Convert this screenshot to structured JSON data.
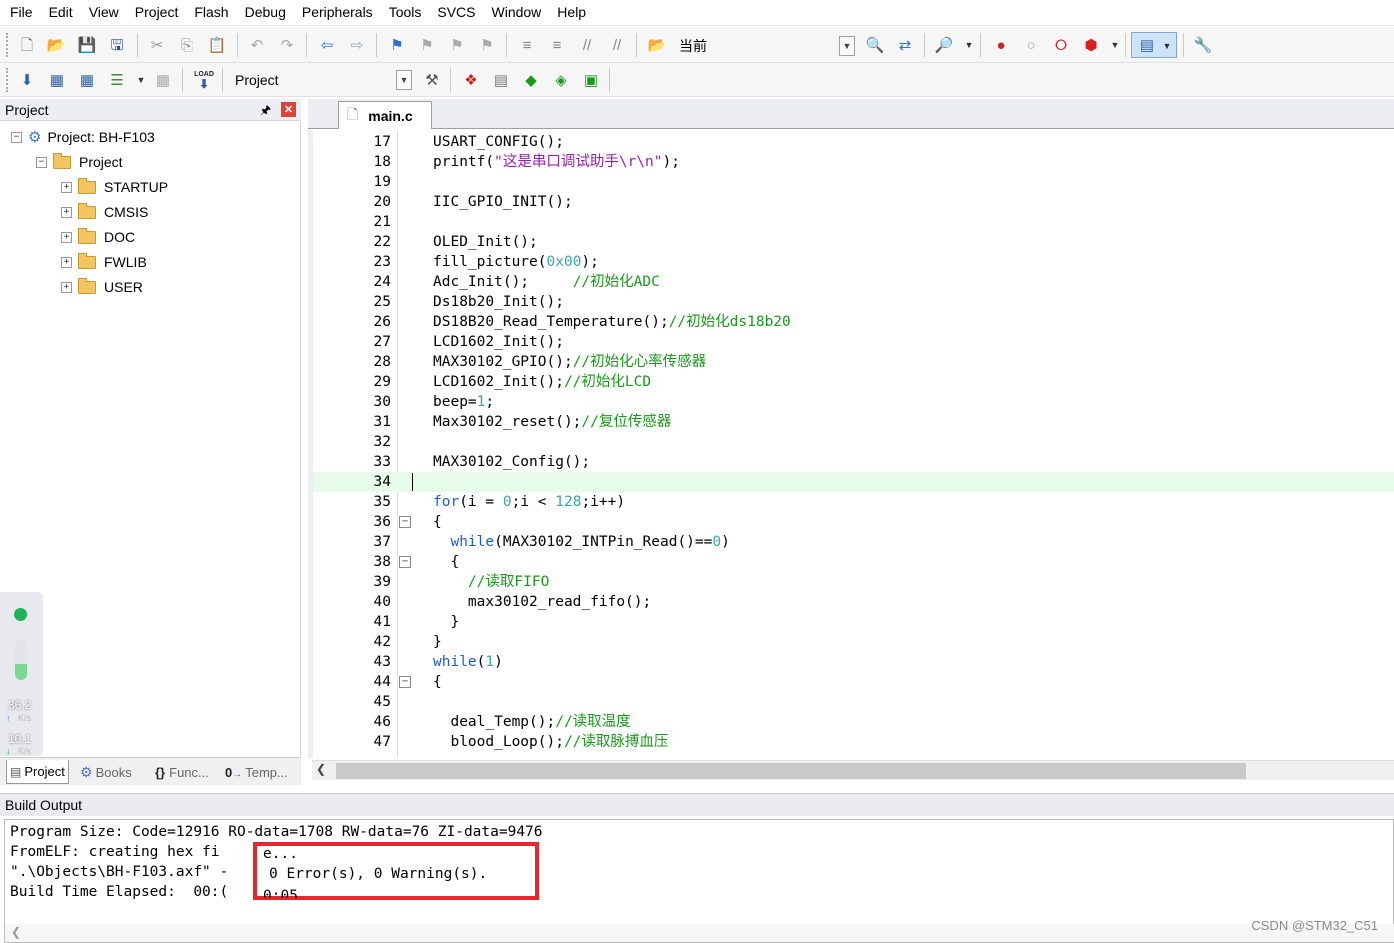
{
  "menu": [
    "File",
    "Edit",
    "View",
    "Project",
    "Flash",
    "Debug",
    "Peripherals",
    "Tools",
    "SVCS",
    "Window",
    "Help"
  ],
  "toolbar1": {
    "combo_value": "当前"
  },
  "toolbar2": {
    "target_value": "Project",
    "load_label": "LOAD"
  },
  "project_panel": {
    "title": "Project",
    "tree": {
      "root": "Project: BH-F103",
      "group": "Project",
      "folders": [
        "STARTUP",
        "CMSIS",
        "DOC",
        "FWLIB",
        "USER"
      ]
    },
    "tabs": [
      "Project",
      "Books",
      "Func...",
      "Temp..."
    ]
  },
  "net_widget": {
    "upload_value": "36.2",
    "upload_unit": "K/s",
    "download_value": "10.1",
    "download_unit": "K/s"
  },
  "editor": {
    "tab": "main.c",
    "lines": [
      {
        "n": "17",
        "code": "USART_CONFIG();"
      },
      {
        "n": "18",
        "code": "printf(\"这是串口调试助手\\r\\n\");"
      },
      {
        "n": "19",
        "code": ""
      },
      {
        "n": "20",
        "code": "IIC_GPIO_INIT();"
      },
      {
        "n": "21",
        "code": ""
      },
      {
        "n": "22",
        "code": "OLED_Init();"
      },
      {
        "n": "23",
        "code": "fill_picture(0x00);"
      },
      {
        "n": "24",
        "code": "Adc_Init();     //初始化ADC"
      },
      {
        "n": "25",
        "code": "Ds18b20_Init();"
      },
      {
        "n": "26",
        "code": "DS18B20_Read_Temperature();//初始化ds18b20"
      },
      {
        "n": "27",
        "code": "LCD1602_Init();"
      },
      {
        "n": "28",
        "code": "MAX30102_GPIO();//初始化心率传感器"
      },
      {
        "n": "29",
        "code": "LCD1602_Init();//初始化LCD"
      },
      {
        "n": "30",
        "code": "beep=1;"
      },
      {
        "n": "31",
        "code": "Max30102_reset();//复位传感器"
      },
      {
        "n": "32",
        "code": ""
      },
      {
        "n": "33",
        "code": "MAX30102_Config();"
      },
      {
        "n": "34",
        "code": ""
      },
      {
        "n": "35",
        "code": "for(i = 0;i < 128;i++)"
      },
      {
        "n": "36",
        "code": "{"
      },
      {
        "n": "37",
        "code": "  while(MAX30102_INTPin_Read()==0)"
      },
      {
        "n": "38",
        "code": "  {"
      },
      {
        "n": "39",
        "code": "    //读取FIFO"
      },
      {
        "n": "40",
        "code": "    max30102_read_fifo();"
      },
      {
        "n": "41",
        "code": "  }"
      },
      {
        "n": "42",
        "code": "}"
      },
      {
        "n": "43",
        "code": "while(1)"
      },
      {
        "n": "44",
        "code": "{"
      },
      {
        "n": "45",
        "code": ""
      },
      {
        "n": "46",
        "code": "  deal_Temp();//读取温度"
      },
      {
        "n": "47",
        "code": "  blood_Loop();//读取脉搏血压"
      }
    ]
  },
  "build_output": {
    "title": "Build Output",
    "lines": [
      "Program Size: Code=12916 RO-data=1708 RW-data=76 ZI-data=9476",
      "FromELF: creating hex fi",
      "\".\\Objects\\BH-F103.axf\" -",
      "Build Time Elapsed:  00:("
    ],
    "highlight": {
      "line1": "e...",
      "line2": "0 Error(s), 0 Warning(s).",
      "line3": "0:05"
    }
  },
  "watermark": "CSDN @STM32_C51"
}
